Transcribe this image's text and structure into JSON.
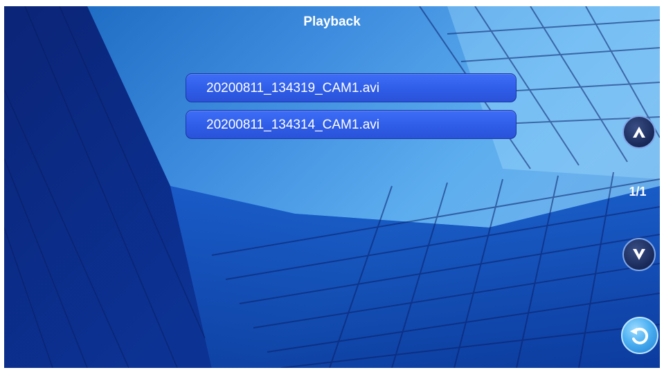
{
  "header": {
    "title": "Playback"
  },
  "files": [
    {
      "name": "20200811_134319_CAM1.avi"
    },
    {
      "name": "20200811_134314_CAM1.avi"
    }
  ],
  "pagination": {
    "indicator": "1/1"
  },
  "icons": {
    "up": "chevron-up-icon",
    "down": "chevron-down-icon",
    "back": "return-arrow-icon"
  },
  "colors": {
    "background": "#1552c4",
    "list_item": "#3466f0",
    "nav_button": "#1a2a5a",
    "back_button": "#4cb0f2",
    "text": "#ffffff"
  }
}
